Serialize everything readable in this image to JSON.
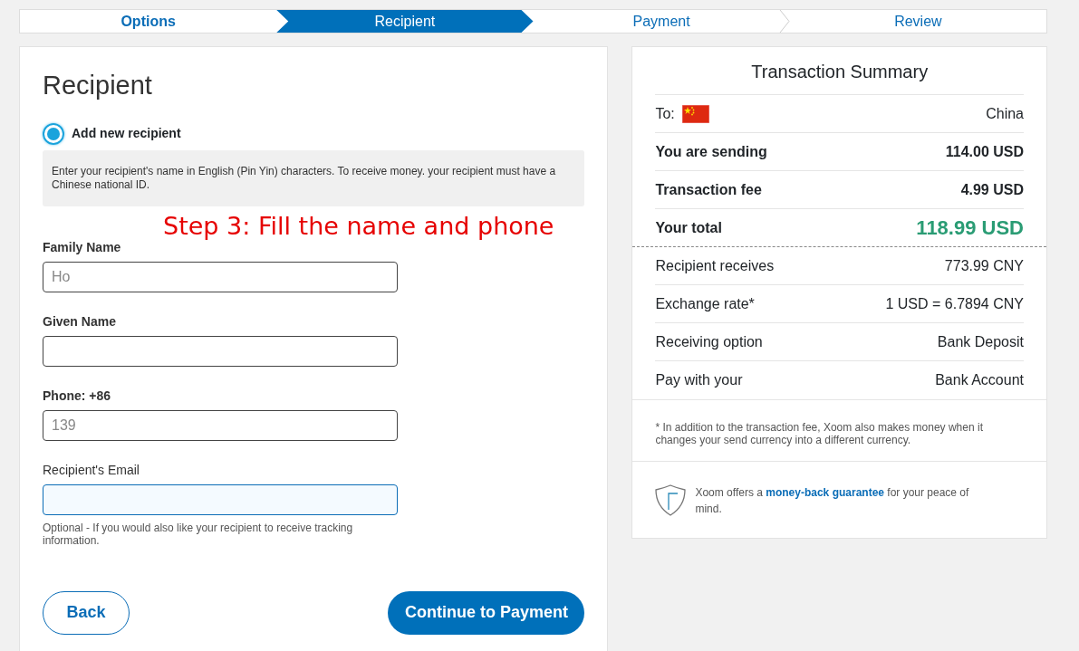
{
  "steps": [
    {
      "label": "Options",
      "selected": false,
      "completed": true
    },
    {
      "label": "Recipient",
      "selected": true,
      "completed": false
    },
    {
      "label": "Payment",
      "selected": false,
      "completed": false
    },
    {
      "label": "Review",
      "selected": false,
      "completed": false
    }
  ],
  "form": {
    "title": "Recipient",
    "option": {
      "label": "Add new recipient",
      "selected": true
    },
    "info": "Enter your recipient's name in English (Pin Yin) characters. To receive money. your recipient must have a Chinese national ID.",
    "annotation": "Step 3: Fill the name and phone",
    "fields": [
      {
        "label": "Family Name",
        "value": "Ho",
        "bold": true,
        "focused": false
      },
      {
        "label": "Given Name",
        "bold": true,
        "focused": false
      },
      {
        "label": "Phone: +86",
        "value": "139",
        "bold": true,
        "focused": false
      },
      {
        "label": "Recipient's Email",
        "bold": false,
        "focused": true,
        "help": "Optional - If you would also like your recipient to receive tracking information."
      }
    ],
    "back": "Back",
    "continue": "Continue to Payment"
  },
  "summary": {
    "title": "Transaction Summary",
    "to_label": "To:",
    "to_value": "China",
    "rows": [
      {
        "label": "You are sending",
        "value": "114.00  USD",
        "kind": "bold"
      },
      {
        "label": "Transaction fee",
        "value": "4.99  USD",
        "kind": "bold"
      },
      {
        "label": "Your total",
        "value": "118.99  USD",
        "kind": "total"
      },
      {
        "label": "Recipient receives",
        "value": "773.99  CNY",
        "kind": "plain"
      },
      {
        "label": "Exchange rate*",
        "value": "1 USD = 6.7894 CNY",
        "kind": "plain"
      },
      {
        "label": "Receiving option",
        "value": "Bank Deposit",
        "kind": "plain"
      },
      {
        "label": "Pay with your",
        "value": "Bank Account",
        "kind": "plain"
      }
    ],
    "note": "*  In addition to the transaction fee, Xoom also makes money when it changes your send currency into a different currency.",
    "guarantee": "Xoom offers a **money-back guarantee** for your peace of mind."
  }
}
